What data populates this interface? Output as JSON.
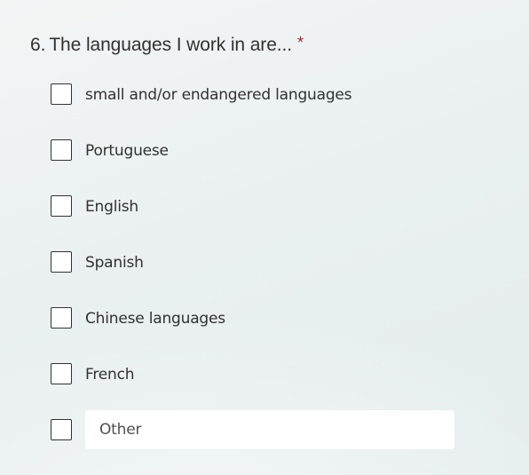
{
  "question": {
    "number": "6.",
    "title": "The languages I work in are...",
    "required_marker": "*",
    "options": [
      {
        "label": "small and/or endangered languages",
        "checked": false
      },
      {
        "label": "Portuguese",
        "checked": false
      },
      {
        "label": "English",
        "checked": false
      },
      {
        "label": "Spanish",
        "checked": false
      },
      {
        "label": "Chinese languages",
        "checked": false
      },
      {
        "label": "French",
        "checked": false
      }
    ],
    "other": {
      "checked": false,
      "placeholder": "Other",
      "value": ""
    }
  }
}
